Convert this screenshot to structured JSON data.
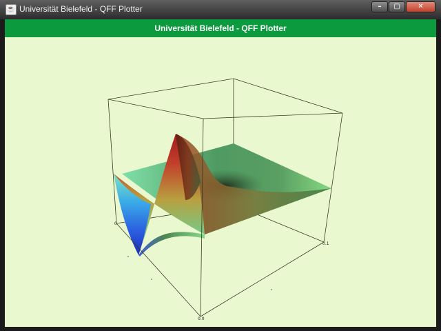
{
  "window": {
    "title": "Universität Bielefeld - QFF Plotter",
    "icon": "java-cup-icon",
    "controls": {
      "minimize_icon": "minimize-icon",
      "maximize_icon": "maximize-icon",
      "close_icon": "close-icon"
    }
  },
  "panel": {
    "header_title": "Universität Bielefeld - QFF Plotter",
    "background": "#e9f8cf",
    "header_color": "#0b9a3e"
  },
  "plot": {
    "kind": "3d-surface",
    "colormap": [
      "#1f3fd6",
      "#3aa0e6",
      "#7fd6a0",
      "#c8a84a",
      "#b8251e"
    ],
    "tick_labels": {
      "left_corner": "0",
      "front_corner": "0.0",
      "right_corner": "0.1"
    }
  }
}
